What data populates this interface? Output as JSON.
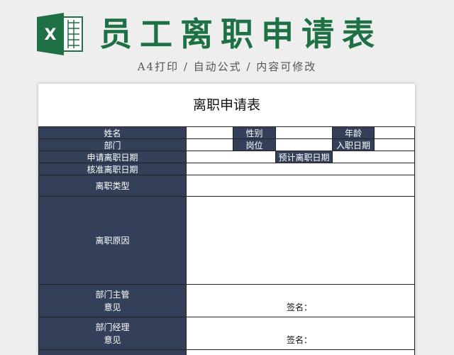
{
  "header": {
    "title": "员工离职申请表",
    "subtitle": "A4打印 / 自动公式 / 内容可修改",
    "logo_letter": "X"
  },
  "form": {
    "title": "离职申请表",
    "labels": {
      "name": "姓名",
      "gender": "性别",
      "age": "年龄",
      "department": "部门",
      "position": "岗位",
      "hire_date": "入职日期",
      "apply_date": "申请离职日期",
      "expected_date": "预计离职日期",
      "approved_date": "核准离职日期",
      "type": "离职类型",
      "reason": "离职原因",
      "supervisor_line1": "部门主管",
      "supervisor_line2": "意见",
      "manager_line1": "部门经理",
      "manager_line2": "意见"
    },
    "signature_label": "签名："
  },
  "colors": {
    "label_bg": "#34405a",
    "title_green": "#1e7145",
    "excel_green": "#1e7145"
  }
}
